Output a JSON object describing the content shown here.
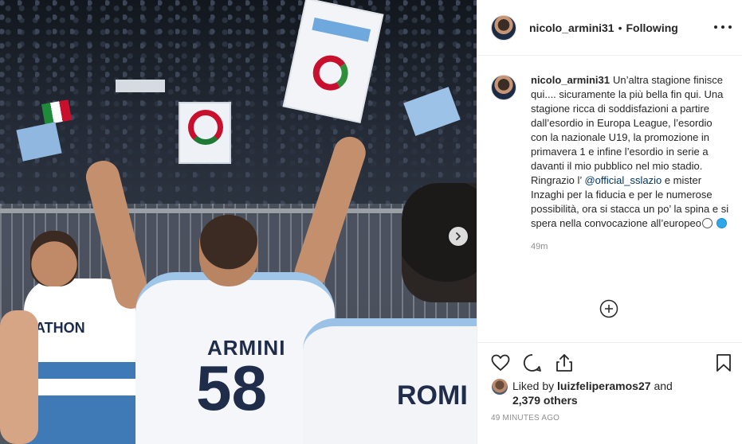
{
  "post": {
    "username": "nicolo_armini31",
    "dot": "•",
    "follow_status": "Following",
    "caption_text": "Un’altra stagione finisce qui.... sicuramente la più bella fin qui. Una stagione ricca di soddisfazioni a partire dall’esordio in Europa League, l’esordio con la nazionale U19, la promozione in primavera 1 e infine l’esordio in serie a davanti il mio pubblico nel mio stadio. Ringrazio l’ ",
    "mention": "@official_sslazio",
    "caption_text_2": " e mister Inzaghi per la fiducia e per le numerose possibilità, ora si stacca un po’ la spina e si spera nella convocazione all’europeo",
    "comment_time": "49m",
    "liked_by_prefix": "Liked by",
    "liked_by_user": "luizfeliperamos27",
    "liked_by_and": "and",
    "others": "2,379 others",
    "timestamp": "49 MINUTES AGO"
  },
  "media": {
    "jersey_left": "ATHON",
    "jersey_center_name": "ARMINI",
    "jersey_center_number": "58",
    "jersey_right": "ROMI"
  },
  "icons": {
    "more": "more-options-icon",
    "next": "chevron-right-icon",
    "load_more": "plus-circle-icon",
    "like": "heart-icon",
    "comment": "comment-icon",
    "share": "share-icon",
    "save": "bookmark-icon"
  },
  "colors": {
    "text": "#262626",
    "muted": "#8e8e8e",
    "mention": "#003569",
    "border": "#efefef"
  }
}
